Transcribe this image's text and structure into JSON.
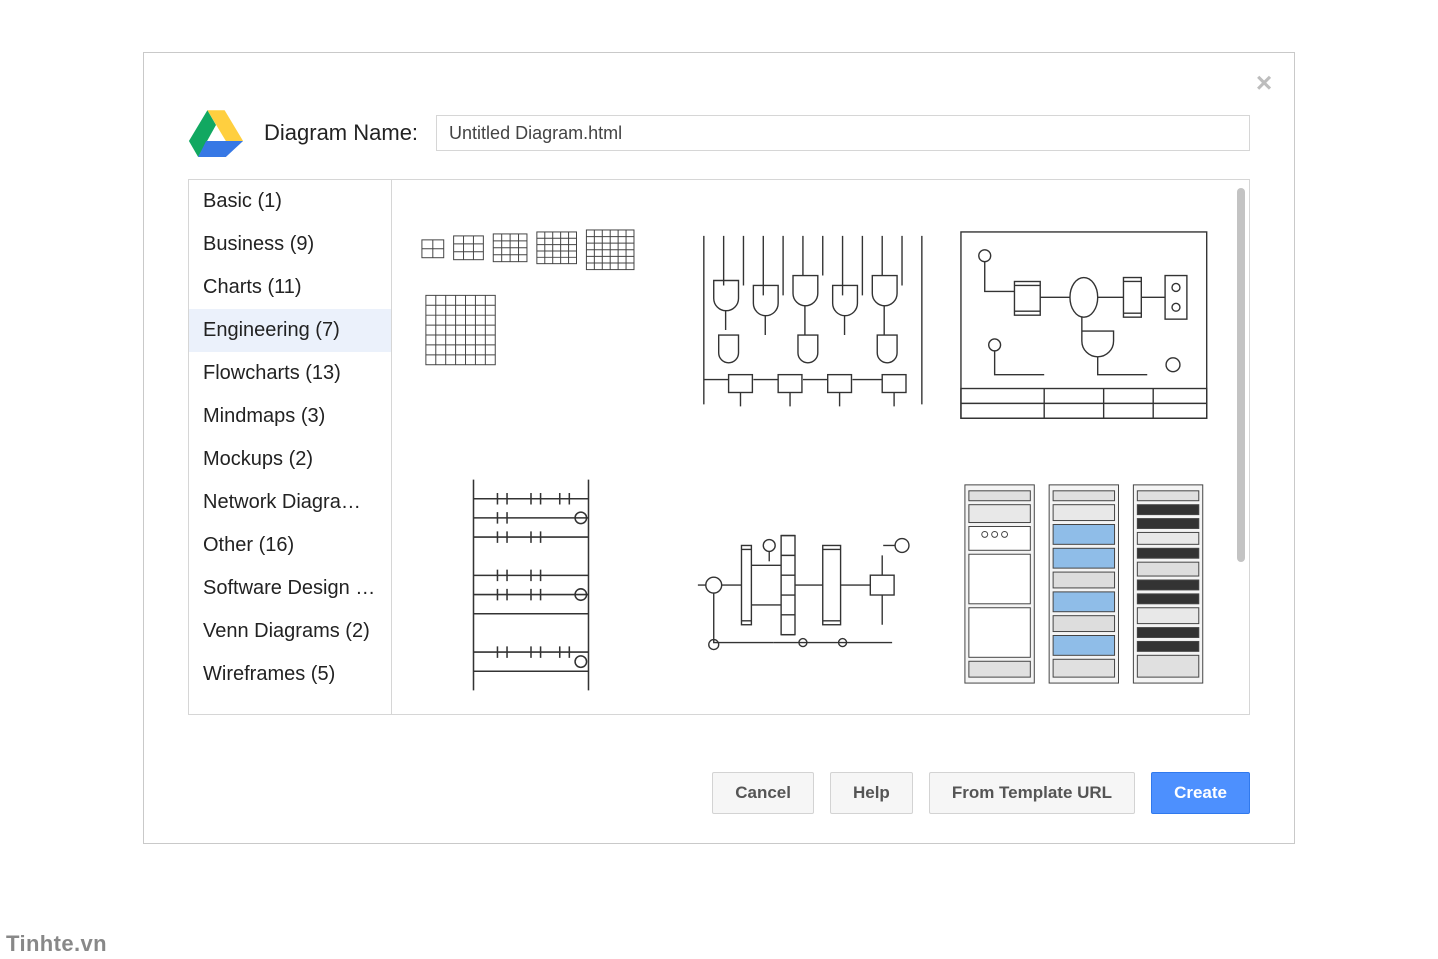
{
  "header": {
    "name_label": "Diagram Name:",
    "name_value": "Untitled Diagram.html"
  },
  "sidebar": {
    "items": [
      {
        "label": "Basic (1)",
        "selected": false
      },
      {
        "label": "Business (9)",
        "selected": false
      },
      {
        "label": "Charts (11)",
        "selected": false
      },
      {
        "label": "Engineering (7)",
        "selected": true
      },
      {
        "label": "Flowcharts (13)",
        "selected": false
      },
      {
        "label": "Mindmaps (3)",
        "selected": false
      },
      {
        "label": "Mockups (2)",
        "selected": false
      },
      {
        "label": "Network Diagram…",
        "selected": false
      },
      {
        "label": "Other (16)",
        "selected": false
      },
      {
        "label": "Software Design (…",
        "selected": false
      },
      {
        "label": "Venn Diagrams (2)",
        "selected": false
      },
      {
        "label": "Wireframes (5)",
        "selected": false
      }
    ]
  },
  "gallery": {
    "templates": [
      {
        "name": "engineering-grids"
      },
      {
        "name": "engineering-circuit"
      },
      {
        "name": "engineering-process-flow"
      },
      {
        "name": "engineering-ladder"
      },
      {
        "name": "engineering-piping"
      },
      {
        "name": "engineering-server-racks"
      }
    ]
  },
  "footer": {
    "cancel": "Cancel",
    "help": "Help",
    "from_url": "From Template URL",
    "create": "Create"
  },
  "watermark": "Tinhte.vn"
}
